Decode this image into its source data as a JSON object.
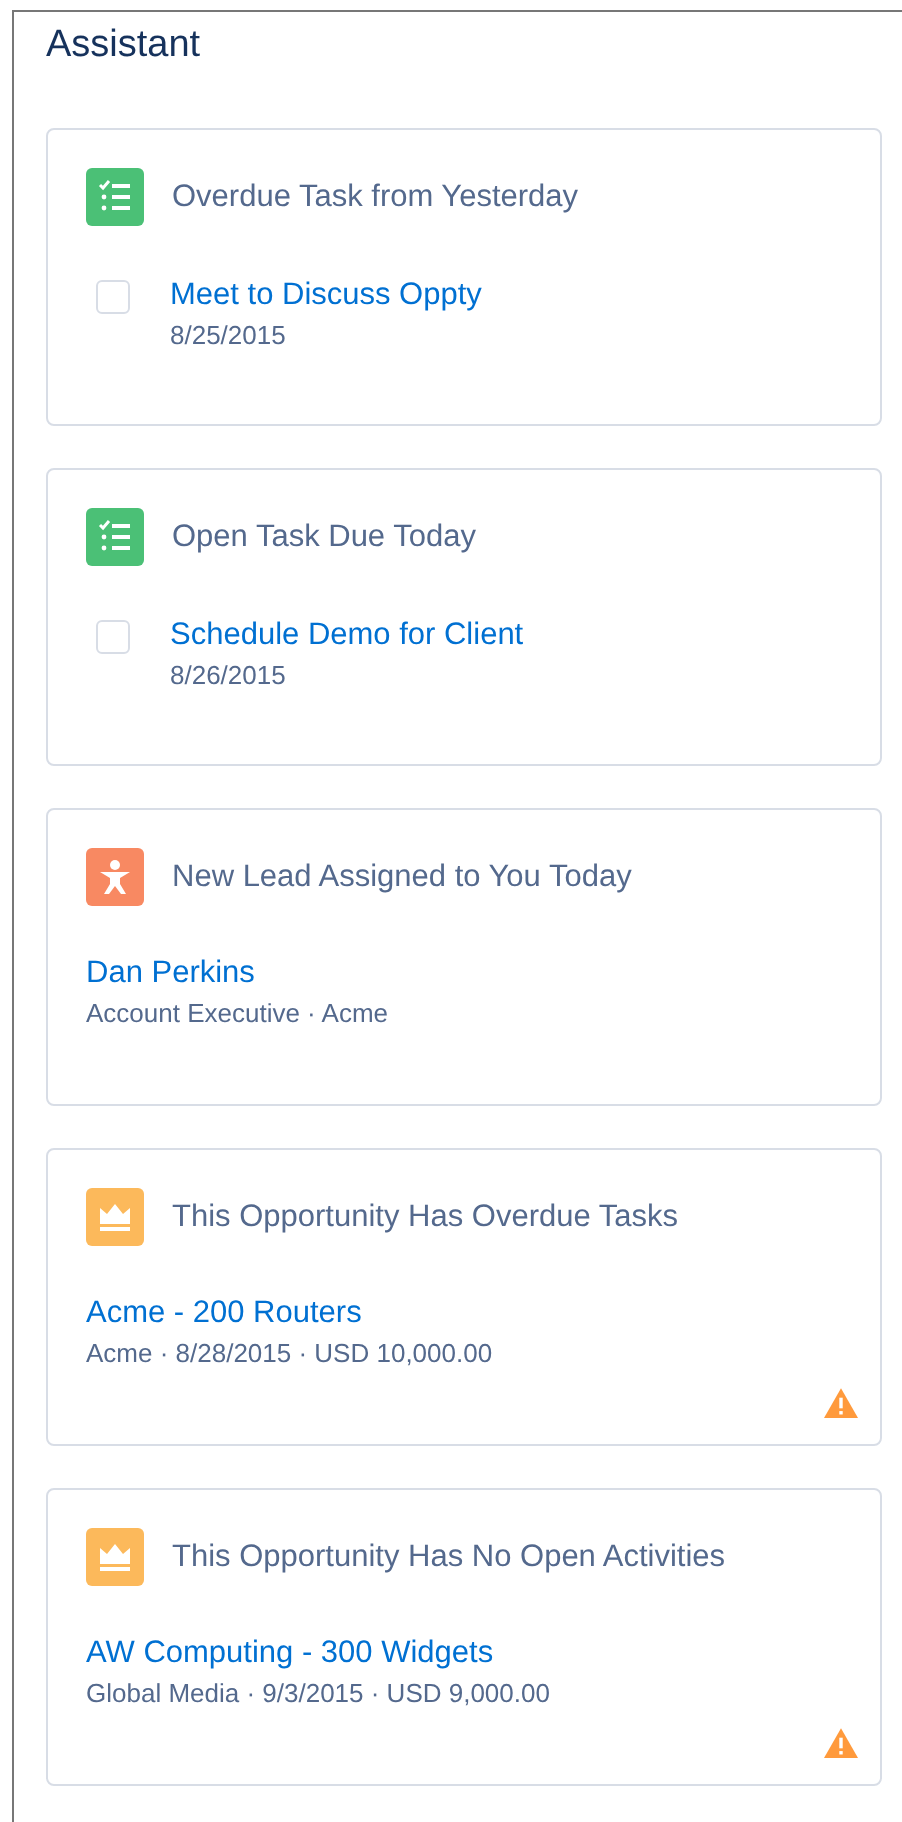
{
  "title": "Assistant",
  "cards": [
    {
      "kind": "task",
      "heading": "Overdue Task from Yesterday",
      "checked": false,
      "link": "Meet to Discuss Oppty",
      "detail": "8/25/2015",
      "warning": false
    },
    {
      "kind": "task",
      "heading": "Open Task Due Today",
      "checked": false,
      "link": "Schedule Demo for Client",
      "detail": "8/26/2015",
      "warning": false
    },
    {
      "kind": "lead",
      "heading": "New Lead Assigned to You Today",
      "link": "Dan Perkins",
      "detail": "Account Executive · Acme",
      "warning": false
    },
    {
      "kind": "opportunity",
      "heading": "This Opportunity Has Overdue Tasks",
      "link": "Acme - 200 Routers",
      "detail": "Acme · 8/28/2015 · USD 10,000.00",
      "warning": true
    },
    {
      "kind": "opportunity",
      "heading": "This Opportunity Has No Open Activities",
      "link": "AW Computing - 300 Widgets",
      "detail": "Global Media · 9/3/2015 · USD 9,000.00",
      "warning": true
    }
  ]
}
